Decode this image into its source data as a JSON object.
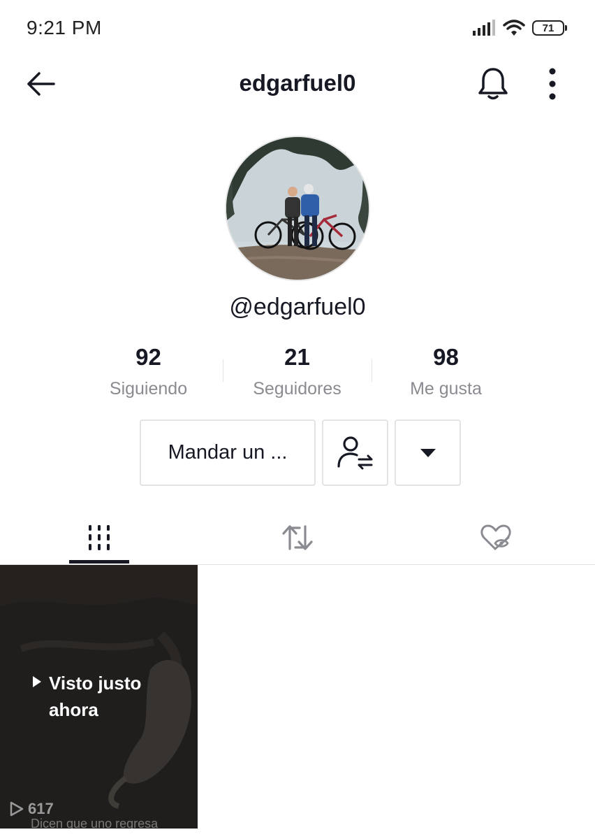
{
  "status_bar": {
    "time": "9:21 PM",
    "battery": "71",
    "icons": [
      "signal-icon",
      "wifi-icon",
      "battery-icon"
    ]
  },
  "nav": {
    "title": "edgarfuel0",
    "icons": [
      "back-arrow-icon",
      "bell-icon",
      "more-vertical-icon"
    ]
  },
  "profile": {
    "handle": "@edgarfuel0",
    "avatar_icon": "profile-photo"
  },
  "stats": [
    {
      "value": "92",
      "label": "Siguiendo"
    },
    {
      "value": "21",
      "label": "Seguidores"
    },
    {
      "value": "98",
      "label": "Me gusta"
    }
  ],
  "actions": {
    "message_label": "Mandar un ...",
    "friend_icon": "user-swap-icon",
    "more_icon": "caret-down-icon"
  },
  "tabs": [
    {
      "icon": "grid-bars-icon",
      "active": true
    },
    {
      "icon": "repost-icon",
      "active": false
    },
    {
      "icon": "heart-hidden-icon",
      "active": false
    }
  ],
  "videos": [
    {
      "watched_label": "Visto justo ahora",
      "views": "617",
      "caption": "Dicen que uno regresa"
    }
  ],
  "colors": {
    "text": "#161823",
    "muted": "#8a8b91",
    "border": "#e3e3e4",
    "background": "#ffffff"
  }
}
